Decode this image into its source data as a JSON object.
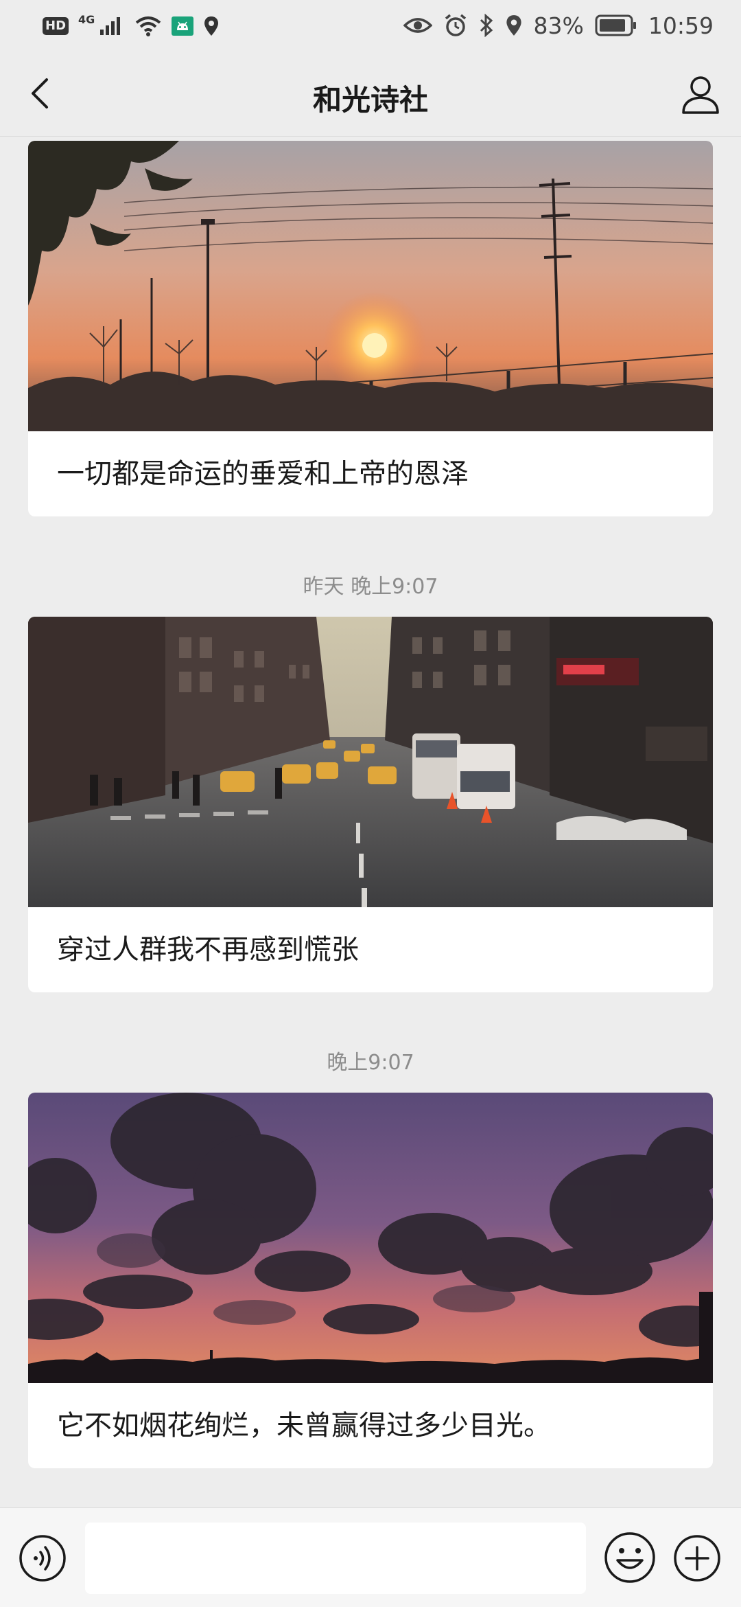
{
  "status_bar": {
    "hd": "HD",
    "network": "4G",
    "battery_percent": "83%",
    "time": "10:59",
    "icons": [
      "hd-icon",
      "signal-icon",
      "wifi-icon",
      "android-icon",
      "location-icon",
      "eye-icon",
      "alarm-icon",
      "bluetooth-icon",
      "location-icon",
      "battery-icon"
    ]
  },
  "nav": {
    "title": "和光诗社",
    "back_icon": "chevron-left-icon",
    "profile_icon": "person-icon"
  },
  "feed": [
    {
      "timestamp": "",
      "image": "sunset-fence-photo",
      "caption": "一切都是命运的垂爱和上帝的恩泽"
    },
    {
      "timestamp": "昨天 晚上9:07",
      "image": "city-street-photo",
      "caption": "穿过人群我不再感到慌张"
    },
    {
      "timestamp": "晚上9:07",
      "image": "purple-sky-clouds-photo",
      "caption": "它不如烟花绚烂，未曾赢得过多少目光。"
    }
  ],
  "input_bar": {
    "voice_icon": "voice-icon",
    "input_value": "",
    "emoji_icon": "emoji-icon",
    "plus_icon": "plus-icon"
  },
  "colors": {
    "background": "#ededed",
    "card": "#ffffff",
    "timestamp": "#8c8c8c",
    "text": "#1a1a1a"
  }
}
